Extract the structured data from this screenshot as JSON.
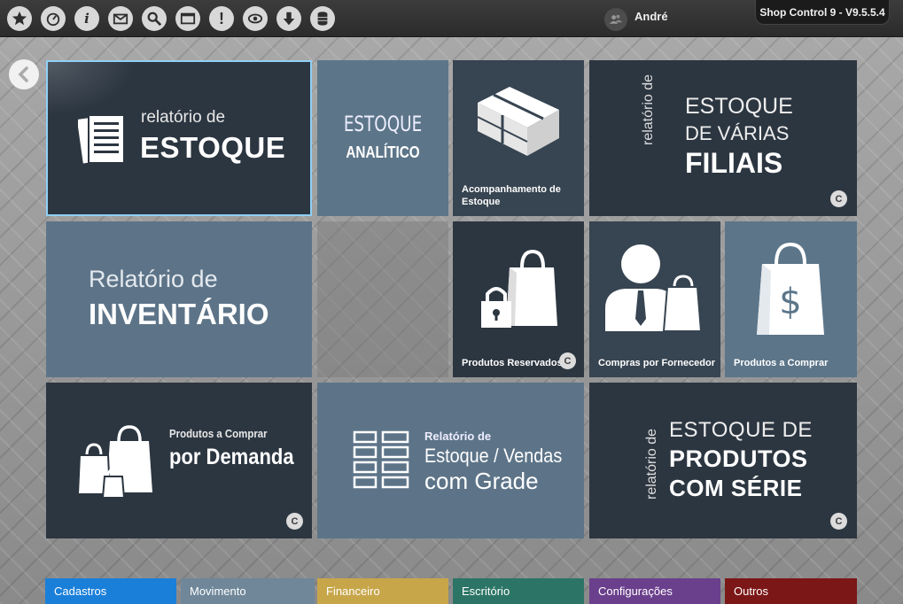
{
  "topbar": {
    "icons": [
      "star-icon",
      "dashboard-icon",
      "info-icon",
      "mail-icon",
      "search-icon",
      "window-icon",
      "alert-icon",
      "eye-icon",
      "download-icon",
      "database-icon"
    ],
    "info_glyph": "i",
    "alert_glyph": "!",
    "user_name": "André",
    "version": "Shop Control 9 - V9.5.5.4"
  },
  "tiles": {
    "relatorio_estoque": {
      "line1": "relatório de",
      "line2": "ESTOQUE"
    },
    "estoque_analitico": {
      "line1": "ESTOQUE",
      "line2": "ANALÍTICO"
    },
    "acompanhamento": {
      "line1": "Acompanhamento de",
      "line2": "Estoque"
    },
    "varias_filiais": {
      "side": "relatório de",
      "line1": "ESTOQUE",
      "line2": "DE VÁRIAS",
      "line3": "FILIAIS",
      "badge": "C"
    },
    "inventario": {
      "line1": "Relatório de",
      "line2": "INVENTÁRIO"
    },
    "produtos_reservados": {
      "label": "Produtos Reservados",
      "badge": "C"
    },
    "compras_fornecedor": {
      "label": "Compras por Fornecedor"
    },
    "produtos_comprar": {
      "label": "Produtos a Comprar",
      "symbol": "$"
    },
    "por_demanda": {
      "line1": "Produtos a Comprar",
      "line2": "por Demanda",
      "badge": "C"
    },
    "grade": {
      "line1": "Relatório de",
      "line2": "Estoque / Vendas",
      "line3": "com Grade"
    },
    "produtos_serie": {
      "side": "relatório de",
      "line1": "ESTOQUE DE",
      "line2": "PRODUTOS",
      "line3": "COM SÉRIE",
      "badge": "C"
    }
  },
  "bottom_tabs": [
    {
      "label": "Cadastros",
      "color": "#1a7fd9"
    },
    {
      "label": "Movimento",
      "color": "#6f8799"
    },
    {
      "label": "Financeiro",
      "color": "#c7a64a"
    },
    {
      "label": "Escritório",
      "color": "#2c7566"
    },
    {
      "label": "Configurações",
      "color": "#6a3f8c"
    },
    {
      "label": "Outros",
      "color": "#7c1717"
    }
  ],
  "colors": {
    "accent_border": "#8fd0f5"
  }
}
